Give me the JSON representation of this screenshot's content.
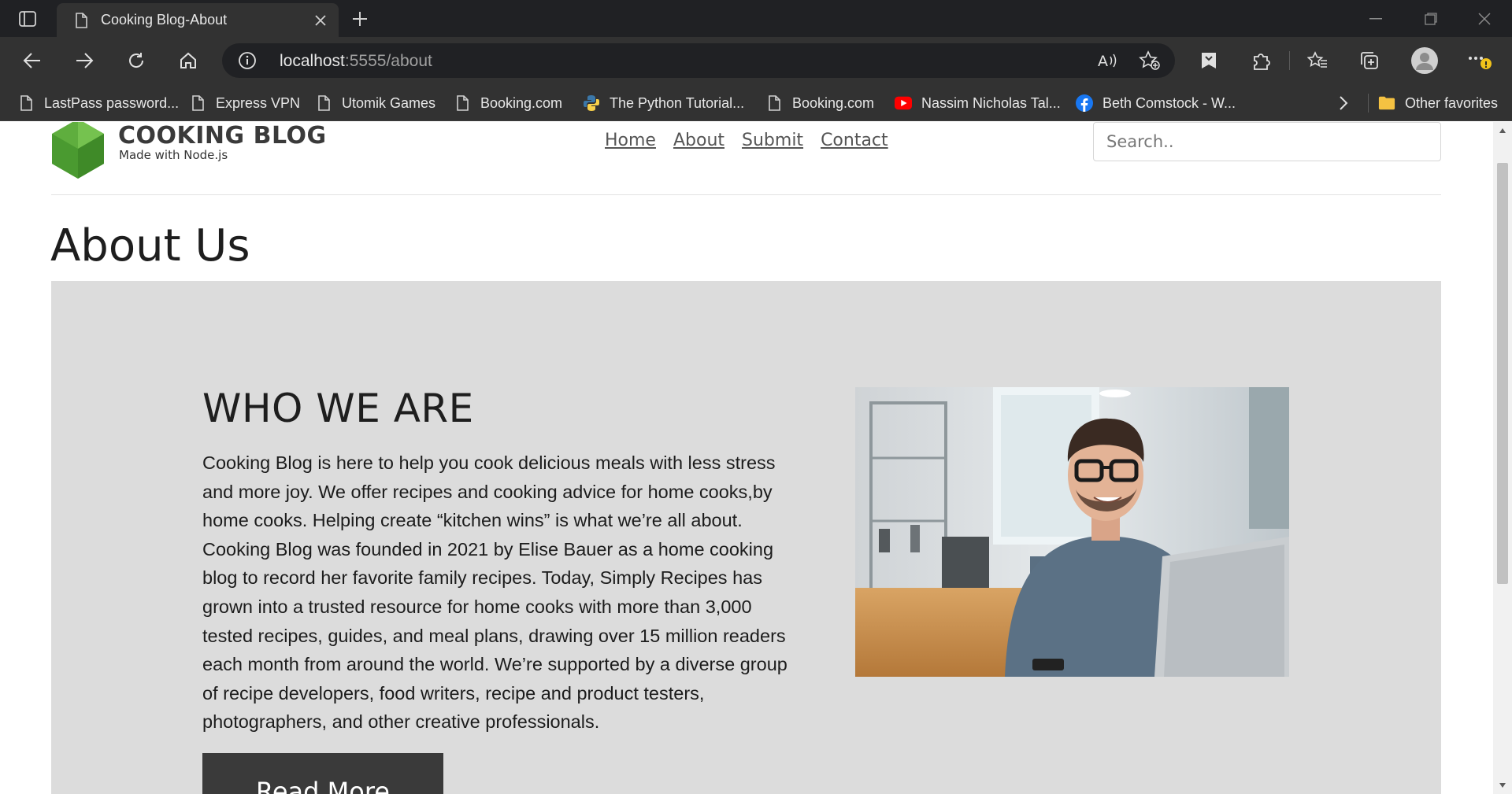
{
  "browser": {
    "tab_title": "Cooking Blog-About",
    "url_host": "localhost",
    "url_rest": ":5555/about",
    "bookmarks": [
      {
        "label": "LastPass password...",
        "icon": "page-icon"
      },
      {
        "label": "Express VPN",
        "icon": "page-icon"
      },
      {
        "label": "Utomik Games",
        "icon": "page-icon"
      },
      {
        "label": "Booking.com",
        "icon": "page-icon"
      },
      {
        "label": "The Python Tutorial...",
        "icon": "python-icon"
      },
      {
        "label": "Booking.com",
        "icon": "page-icon"
      },
      {
        "label": "Nassim Nicholas Tal...",
        "icon": "youtube-icon"
      },
      {
        "label": "Beth Comstock - W...",
        "icon": "facebook-icon"
      }
    ],
    "other_favorites": "Other favorites"
  },
  "site": {
    "brand_title": "COOKING BLOG",
    "brand_subtitle": "Made with Node.js",
    "nav": [
      "Home",
      "About",
      "Submit",
      "Contact"
    ],
    "search_placeholder": "Search.."
  },
  "page": {
    "title": "About Us",
    "who_heading": "WHO WE ARE",
    "who_text": "Cooking Blog is here to help you cook delicious meals with less stress and more joy. We offer recipes and cooking advice for home cooks,by home cooks. Helping create “kitchen wins” is what we’re all about. Cooking Blog was founded in 2021 by Elise Bauer as a home cooking blog to record her favorite family recipes. Today, Simply Recipes has grown into a trusted resource for home cooks with more than 3,000 tested recipes, guides, and meal plans, drawing over 15 million readers each month from around the world. We’re supported by a diverse group of recipe developers, food writers, recipe and product testers, photographers, and other creative professionals.",
    "read_more": "Read More"
  },
  "colors": {
    "brand_green": "#5fae3e",
    "hero_bg": "#dcdcdc",
    "button_bg": "#3a3a3a"
  }
}
